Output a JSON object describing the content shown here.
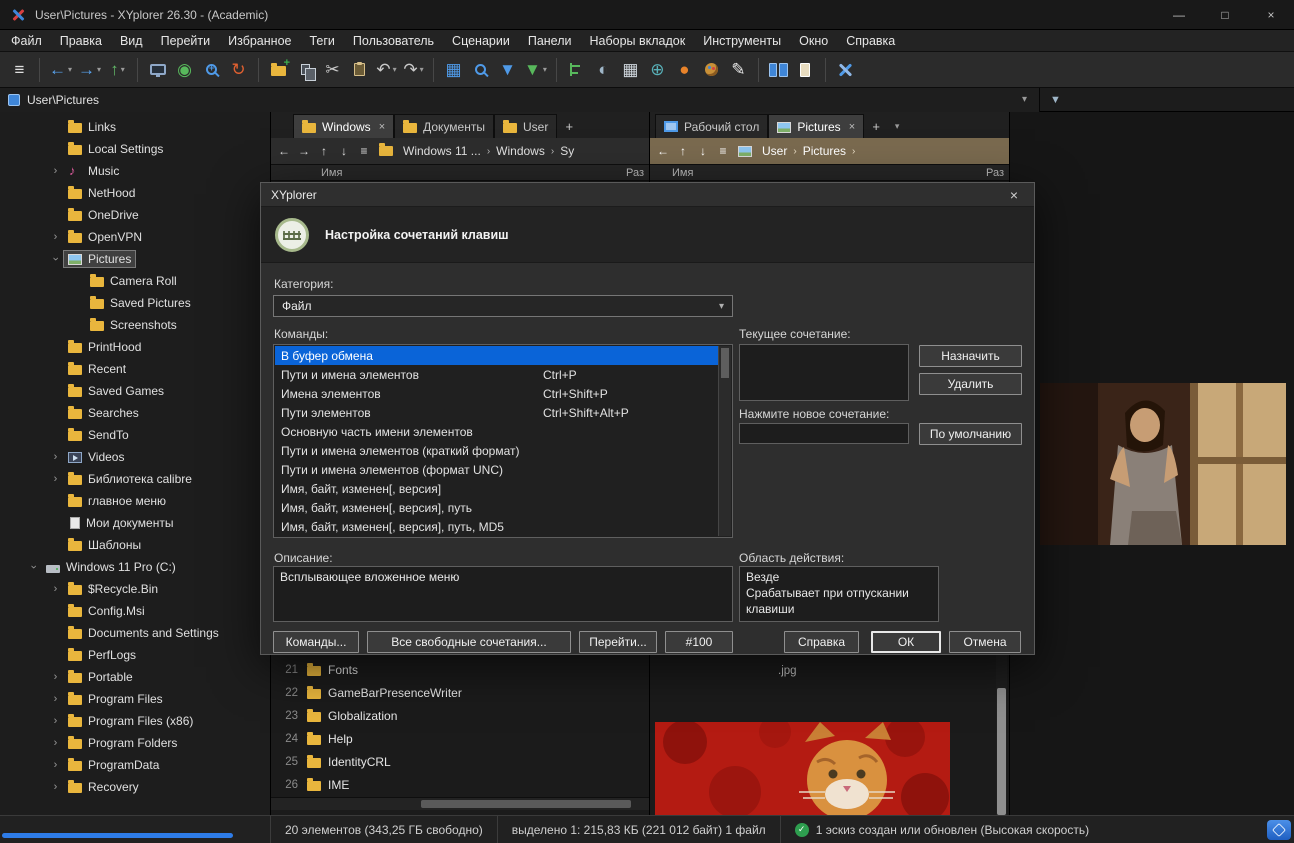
{
  "glyphs": {
    "close": "×",
    "dropdown": "▾",
    "crumb_sep": "›",
    "arrow": "›",
    "plus": "+",
    "check": "✓"
  },
  "window": {
    "title": "User\\Pictures - XYplorer 26.30 - (Academic)",
    "minimize": "—",
    "maximize": "□",
    "close": "×"
  },
  "menu": {
    "items": [
      {
        "key": "file",
        "label": "Файл"
      },
      {
        "key": "edit",
        "label": "Правка"
      },
      {
        "key": "view",
        "label": "Вид"
      },
      {
        "key": "go",
        "label": "Перейти"
      },
      {
        "key": "favorites",
        "label": "Избранное"
      },
      {
        "key": "tags",
        "label": "Теги"
      },
      {
        "key": "user",
        "label": "Пользователь"
      },
      {
        "key": "scripts",
        "label": "Сценарии"
      },
      {
        "key": "panes",
        "label": "Панели"
      },
      {
        "key": "tabsets",
        "label": "Наборы вкладок"
      },
      {
        "key": "tools",
        "label": "Инструменты"
      },
      {
        "key": "window",
        "label": "Окно"
      },
      {
        "key": "help",
        "label": "Справка"
      }
    ]
  },
  "toolbar": {
    "items": [
      {
        "name": "menu-toggle",
        "glyph": "≡",
        "color": "#e0e0e0"
      },
      {
        "sep": true
      },
      {
        "name": "back",
        "glyph": "←",
        "color": "#5aa7f5",
        "dropdown": true
      },
      {
        "name": "forward",
        "glyph": "→",
        "color": "#5aa7f5",
        "dropdown": true
      },
      {
        "name": "up",
        "glyph": "↑",
        "color": "#62b868",
        "dropdown": true
      },
      {
        "sep": true
      },
      {
        "name": "show-display",
        "css": "monitor"
      },
      {
        "name": "goto-location",
        "glyph": "◉",
        "color": "#58b85c"
      },
      {
        "name": "zoom",
        "css": "magplus"
      },
      {
        "name": "refresh",
        "glyph": "↻",
        "color": "#e06030"
      },
      {
        "sep": true
      },
      {
        "name": "new-folder",
        "css": "folderplus"
      },
      {
        "name": "copy",
        "css": "copy"
      },
      {
        "name": "cut",
        "glyph": "✂",
        "color": "#c9c9c9"
      },
      {
        "name": "paste",
        "css": "clipboard"
      },
      {
        "name": "undo",
        "glyph": "↶",
        "color": "#c9c9c9",
        "dropdown": true
      },
      {
        "name": "redo",
        "glyph": "↷",
        "color": "#c9c9c9",
        "dropdown": true
      },
      {
        "sep": true
      },
      {
        "name": "tiles-view",
        "glyph": "▦",
        "color": "#4f9ae8"
      },
      {
        "name": "search",
        "css": "mag"
      },
      {
        "name": "filter",
        "glyph": "▼",
        "color": "#4f9ae8"
      },
      {
        "name": "quick-filter",
        "glyph": "▼",
        "color": "#58b85c",
        "dropdown": true
      },
      {
        "sep": true
      },
      {
        "name": "tree-toggle",
        "css": "tree"
      },
      {
        "name": "dark-mode",
        "glyph": "◐",
        "color": "#9fb6c8"
      },
      {
        "name": "report",
        "glyph": "▦",
        "color": "#cfd6dd"
      },
      {
        "name": "globe",
        "glyph": "⊕",
        "color": "#58b0b8"
      },
      {
        "name": "ball",
        "glyph": "●",
        "color": "#e8832a"
      },
      {
        "name": "colors",
        "css": "palette"
      },
      {
        "name": "brush",
        "glyph": "✎",
        "color": "#e8e8e8"
      },
      {
        "sep": true
      },
      {
        "name": "dual-pane",
        "css": "panes"
      },
      {
        "name": "single-pane",
        "css": "pane1"
      },
      {
        "sep": true
      },
      {
        "name": "customize",
        "css": "wrench"
      }
    ]
  },
  "addressbar": {
    "path": "User\\Pictures"
  },
  "tree": {
    "items": [
      {
        "label": "Links",
        "depth": 2,
        "icon": "folder",
        "expand": ""
      },
      {
        "label": "Local Settings",
        "depth": 2,
        "icon": "folder",
        "expand": ""
      },
      {
        "label": "Music",
        "depth": 2,
        "icon": "music",
        "expand": "closed"
      },
      {
        "label": "NetHood",
        "depth": 2,
        "icon": "folder",
        "expand": ""
      },
      {
        "label": "OneDrive",
        "depth": 2,
        "icon": "folder",
        "expand": ""
      },
      {
        "label": "OpenVPN",
        "depth": 2,
        "icon": "folder",
        "expand": "closed"
      },
      {
        "label": "Pictures",
        "depth": 2,
        "icon": "image",
        "expand": "open",
        "selected": true
      },
      {
        "label": "Camera Roll",
        "depth": 3,
        "icon": "folder",
        "expand": ""
      },
      {
        "label": "Saved Pictures",
        "depth": 3,
        "icon": "folder",
        "expand": ""
      },
      {
        "label": "Screenshots",
        "depth": 3,
        "icon": "folder",
        "expand": ""
      },
      {
        "label": "PrintHood",
        "depth": 2,
        "icon": "folder",
        "expand": ""
      },
      {
        "label": "Recent",
        "depth": 2,
        "icon": "folder",
        "expand": ""
      },
      {
        "label": "Saved Games",
        "depth": 2,
        "icon": "folder",
        "expand": ""
      },
      {
        "label": "Searches",
        "depth": 2,
        "icon": "folder",
        "expand": ""
      },
      {
        "label": "SendTo",
        "depth": 2,
        "icon": "folder",
        "expand": ""
      },
      {
        "label": "Videos",
        "depth": 2,
        "icon": "video",
        "expand": "closed"
      },
      {
        "label": "Библиотека calibre",
        "depth": 2,
        "icon": "folder",
        "expand": "closed"
      },
      {
        "label": "главное меню",
        "depth": 2,
        "icon": "folder",
        "expand": ""
      },
      {
        "label": "Мои документы",
        "depth": 2,
        "icon": "documents",
        "expand": ""
      },
      {
        "label": "Шаблоны",
        "depth": 2,
        "icon": "folder",
        "expand": ""
      },
      {
        "label": "Windows 11 Pro (C:)",
        "depth": 1,
        "icon": "drive",
        "expand": "open"
      },
      {
        "label": "$Recycle.Bin",
        "depth": 2,
        "icon": "folder",
        "expand": "closed"
      },
      {
        "label": "Config.Msi",
        "depth": 2,
        "icon": "folder",
        "expand": ""
      },
      {
        "label": "Documents and Settings",
        "depth": 2,
        "icon": "folder",
        "expand": ""
      },
      {
        "label": "PerfLogs",
        "depth": 2,
        "icon": "folder",
        "expand": ""
      },
      {
        "label": "Portable",
        "depth": 2,
        "icon": "folder",
        "expand": "closed"
      },
      {
        "label": "Program Files",
        "depth": 2,
        "icon": "folder",
        "expand": "closed"
      },
      {
        "label": "Program Files (x86)",
        "depth": 2,
        "icon": "folder",
        "expand": "closed"
      },
      {
        "label": "Program Folders",
        "depth": 2,
        "icon": "folder",
        "expand": "closed"
      },
      {
        "label": "ProgramData",
        "depth": 2,
        "icon": "folder",
        "expand": "closed"
      },
      {
        "label": "Recovery",
        "depth": 2,
        "icon": "folder",
        "expand": "closed"
      }
    ]
  },
  "panes": {
    "left": {
      "tabs": [
        {
          "key": "windows",
          "label": "Windows",
          "icon": "folder",
          "active": true,
          "close": true
        },
        {
          "key": "documents",
          "label": "Документы",
          "icon": "folder"
        },
        {
          "key": "user",
          "label": "User",
          "icon": "folder"
        },
        {
          "key": "new-tab",
          "label": "+",
          "type": "new"
        }
      ],
      "nav": [
        {
          "key": "back",
          "g": "←"
        },
        {
          "key": "forward",
          "g": "→"
        },
        {
          "key": "up",
          "g": "↑"
        },
        {
          "key": "down",
          "g": "↓"
        },
        {
          "key": "menu",
          "g": "≡"
        }
      ],
      "crumb_icon": "folder",
      "segments": [
        "Windows 11 ...",
        "Windows",
        "Sy"
      ],
      "columns": [
        "Имя",
        "Раз"
      ],
      "files": [
        {
          "num": "21",
          "name": "Fonts"
        },
        {
          "num": "22",
          "name": "GameBarPresenceWriter"
        },
        {
          "num": "23",
          "name": "Globalization"
        },
        {
          "num": "24",
          "name": "Help"
        },
        {
          "num": "25",
          "name": "IdentityCRL"
        },
        {
          "num": "26",
          "name": "IME"
        }
      ]
    },
    "right": {
      "tabs": [
        {
          "key": "desktop",
          "label": "Рабочий стол",
          "icon": "monitor"
        },
        {
          "key": "pictures",
          "label": "Pictures",
          "icon": "image",
          "active": true,
          "close": true
        },
        {
          "key": "new-tab",
          "label": "+",
          "type": "new"
        },
        {
          "key": "tab-menu",
          "type": "chevron"
        }
      ],
      "nav": [
        {
          "key": "back",
          "g": "←"
        },
        {
          "key": "up",
          "g": "↑"
        },
        {
          "key": "down",
          "g": "↓"
        },
        {
          "key": "menu",
          "g": "≡"
        }
      ],
      "crumb_icon": "image",
      "segments": [
        "User",
        "Pictures"
      ],
      "trailing": true,
      "columns": [
        "Имя",
        "Раз"
      ],
      "caption": ".jpg"
    }
  },
  "dialog": {
    "title": "XYplorer",
    "close_glyph": "×",
    "heading": "Настройка сочетаний клавиш",
    "category_label": "Категория:",
    "category_value": "Файл",
    "commands_label": "Команды:",
    "commands": [
      {
        "name": "В буфер обмена",
        "shortcut": "",
        "selected": true
      },
      {
        "name": "Пути и имена элементов",
        "shortcut": "Ctrl+P"
      },
      {
        "name": "Имена элементов",
        "shortcut": "Ctrl+Shift+P"
      },
      {
        "name": "Пути элементов",
        "shortcut": "Ctrl+Shift+Alt+P"
      },
      {
        "name": "Основную часть имени элементов",
        "shortcut": ""
      },
      {
        "name": "Пути и имена элементов (краткий формат)",
        "shortcut": ""
      },
      {
        "name": "Пути и имена элементов (формат UNC)",
        "shortcut": ""
      },
      {
        "name": "Имя, байт, изменен[, версия]",
        "shortcut": ""
      },
      {
        "name": "Имя, байт, изменен[, версия], путь",
        "shortcut": ""
      },
      {
        "name": "Имя, байт, изменен[, версия], путь, MD5",
        "shortcut": ""
      }
    ],
    "current_label": "Текущее сочетание:",
    "current_value": "",
    "assign_button": "Назначить",
    "remove_button": "Удалить",
    "new_label": "Нажмите новое сочетание:",
    "new_value": "",
    "default_button": "По умолчанию",
    "description_label": "Описание:",
    "description_value": "Всплывающее вложенное меню",
    "scope_label": "Область действия:",
    "scope_lines": [
      "Везде",
      "Срабатывает при отпускании клавиши"
    ],
    "buttons": {
      "commands": "Команды...",
      "free": "Все свободные сочетания...",
      "goto": "Перейти...",
      "number": "#100",
      "help": "Справка",
      "ok": "ОК",
      "cancel": "Отмена"
    }
  },
  "statusbar": {
    "items": [
      "20 элементов (343,25 ГБ свободно)",
      "выделено 1: 215,83 КБ (221 012 байт) 1 файл",
      "1 эскиз создан или обновлен (Высокая скорость)"
    ]
  }
}
